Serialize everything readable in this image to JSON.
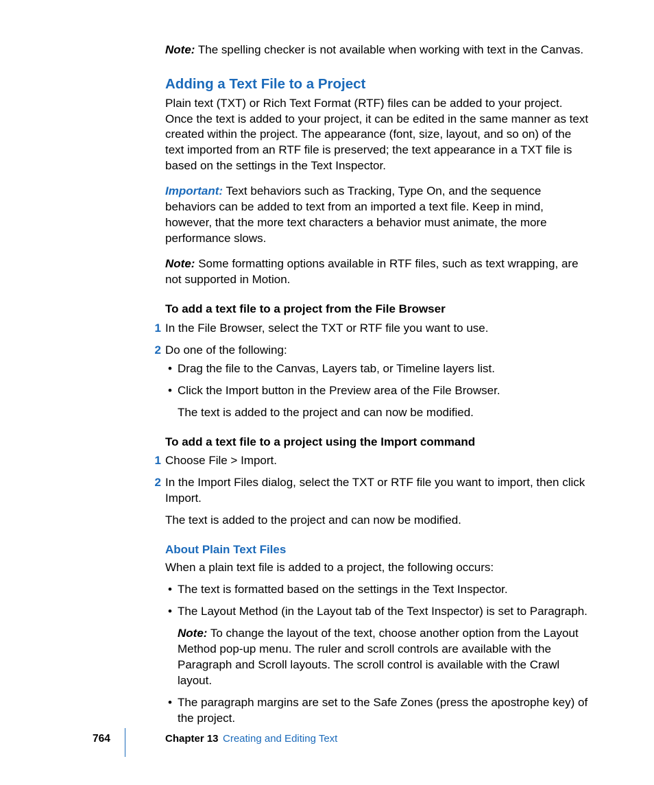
{
  "labels": {
    "note": "Note:",
    "important": "Important:"
  },
  "note_top": "The spelling checker is not available when working with text in the Canvas.",
  "section_heading": "Adding a Text File to a Project",
  "section_intro": "Plain text (TXT) or Rich Text Format (RTF) files can be added to your project. Once the text is added to your project, it can be edited in the same manner as text created within the project. The appearance (font, size, layout, and so on) of the text imported from an RTF file is preserved; the text appearance in a TXT file is based on the settings in the Text Inspector.",
  "important_text": "Text behaviors such as Tracking, Type On, and the sequence behaviors can be added to text from an imported a text file. Keep in mind, however, that the more text characters a behavior must animate, the more performance slows.",
  "note2": "Some formatting options available in RTF files, such as text wrapping, are not supported in Motion.",
  "task1": {
    "heading": "To add a text file to a project from the File Browser",
    "step1": "In the File Browser, select the TXT or RTF file you want to use.",
    "step2": "Do one of the following:",
    "bullets": {
      "b1": "Drag the file to the Canvas, Layers tab, or Timeline layers list.",
      "b2": "Click the Import button in the Preview area of the File Browser.",
      "b2_sub": "The text is added to the project and can now be modified."
    }
  },
  "task2": {
    "heading": "To add a text file to a project using the Import command",
    "step1": "Choose File > Import.",
    "step2": "In the Import Files dialog, select the TXT or RTF file you want to import, then click Import.",
    "after": "The text is added to the project and can now be modified."
  },
  "subsection": {
    "heading": "About Plain Text Files",
    "intro": "When a plain text file is added to a project, the following occurs:",
    "bullets": {
      "b1": "The text is formatted based on the settings in the Text Inspector.",
      "b2": "The Layout Method (in the Layout tab of the Text Inspector) is set to Paragraph.",
      "b2_note": "To change the layout of the text, choose another option from the Layout Method pop-up menu. The ruler and scroll controls are available with the Paragraph and Scroll layouts. The scroll control is available with the Crawl layout.",
      "b3": "The paragraph margins are set to the Safe Zones (press the apostrophe key) of the project."
    }
  },
  "footer": {
    "page": "764",
    "chapter_label": "Chapter 13",
    "chapter_title": "Creating and Editing Text"
  }
}
